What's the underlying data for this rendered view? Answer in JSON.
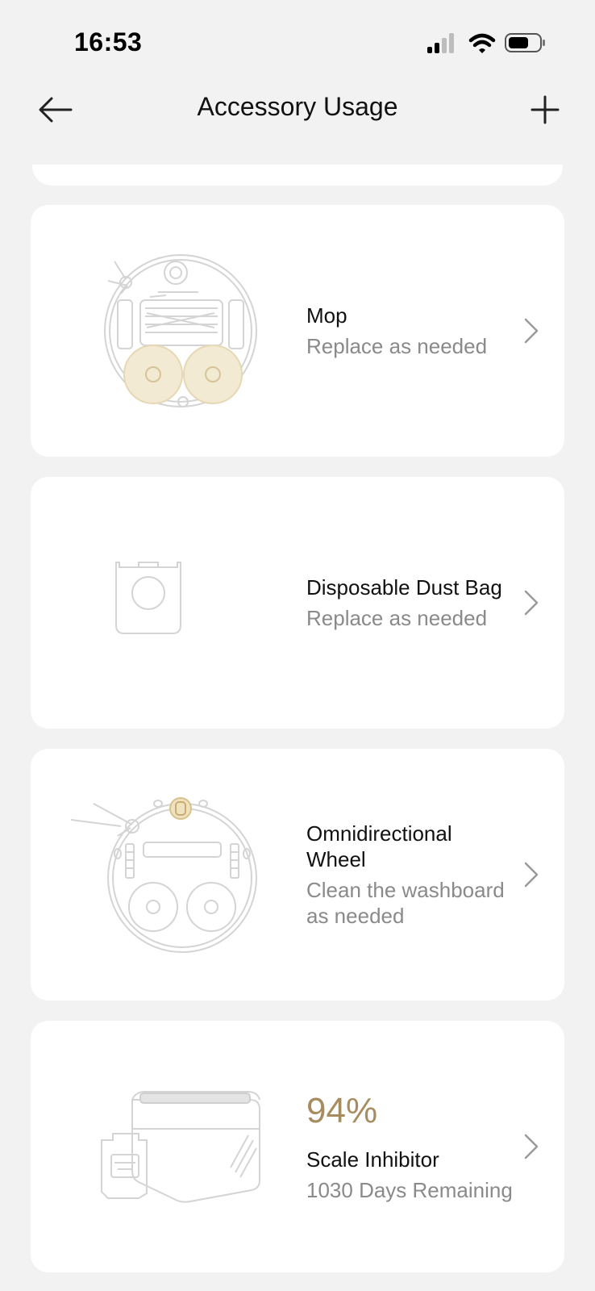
{
  "status_bar": {
    "time": "16:53"
  },
  "nav": {
    "title": "Accessory Usage",
    "back_icon": "arrow-left-icon",
    "add_icon": "plus-icon"
  },
  "colors": {
    "background": "#f2f2f2",
    "card": "#ffffff",
    "accent": "#a78c60",
    "secondary_text": "#8a8a8a"
  },
  "accessories": [
    {
      "title": "Mop",
      "subtitle": "Replace as needed",
      "icon": "robot-mop-illustration"
    },
    {
      "title": "Disposable Dust Bag",
      "subtitle": "Replace as needed",
      "icon": "dust-bag-illustration"
    },
    {
      "title": "Omnidirectional Wheel",
      "subtitle": "Clean the washboard as needed",
      "icon": "robot-wheel-illustration"
    },
    {
      "percent": "94%",
      "progress_percent": 94,
      "title": "Scale Inhibitor",
      "subtitle": "1030 Days Remaining",
      "icon": "scale-inhibitor-illustration"
    }
  ]
}
